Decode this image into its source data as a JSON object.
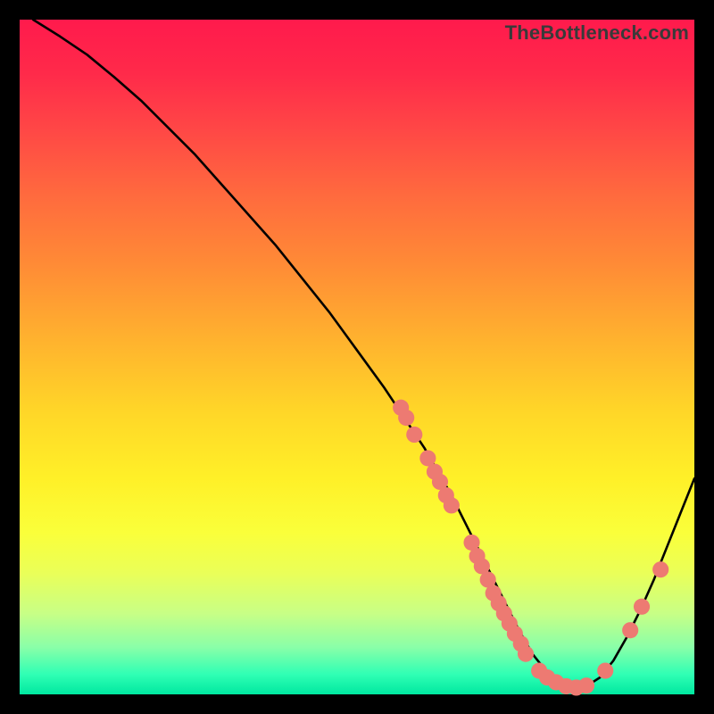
{
  "watermark": "TheBottleneck.com",
  "colors": {
    "dot": "#ed7a72",
    "curve": "#000000",
    "frame_bg_top": "#ff1a4c",
    "frame_bg_bottom": "#00e8a0",
    "page_bg": "#000000"
  },
  "chart_data": {
    "type": "line",
    "title": "",
    "xlabel": "",
    "ylabel": "",
    "xlim": [
      0,
      100
    ],
    "ylim": [
      0,
      100
    ],
    "grid": false,
    "legend": false,
    "series": [
      {
        "name": "curve",
        "x": [
          2,
          6,
          10,
          14,
          18,
          22,
          26,
          30,
          34,
          38,
          42,
          46,
          50,
          54,
          56,
          58,
          60,
          62,
          64,
          66,
          68,
          70,
          72,
          74,
          76,
          78,
          80,
          82,
          84,
          86,
          88,
          90,
          92,
          94,
          96,
          98,
          100
        ],
        "y": [
          100,
          97.5,
          94.8,
          91.5,
          88,
          84,
          80,
          75.5,
          71,
          66.5,
          61.5,
          56.5,
          51,
          45.5,
          42.5,
          39.5,
          36.5,
          33,
          29.5,
          25.5,
          21.5,
          17.5,
          13.5,
          9.5,
          6,
          3.5,
          1.8,
          1,
          1.2,
          2.5,
          5,
          8.5,
          12.5,
          17,
          22,
          27,
          32
        ]
      }
    ],
    "points": [
      {
        "x": 56.5,
        "y": 42.5
      },
      {
        "x": 57.3,
        "y": 41
      },
      {
        "x": 58.5,
        "y": 38.5
      },
      {
        "x": 60.5,
        "y": 35
      },
      {
        "x": 61.5,
        "y": 33
      },
      {
        "x": 62.3,
        "y": 31.5
      },
      {
        "x": 63.2,
        "y": 29.5
      },
      {
        "x": 64,
        "y": 28
      },
      {
        "x": 67,
        "y": 22.5
      },
      {
        "x": 67.8,
        "y": 20.5
      },
      {
        "x": 68.5,
        "y": 19
      },
      {
        "x": 69.4,
        "y": 17
      },
      {
        "x": 70.2,
        "y": 15
      },
      {
        "x": 71,
        "y": 13.5
      },
      {
        "x": 71.8,
        "y": 12
      },
      {
        "x": 72.6,
        "y": 10.5
      },
      {
        "x": 73.4,
        "y": 9
      },
      {
        "x": 74.3,
        "y": 7.5
      },
      {
        "x": 75,
        "y": 6
      },
      {
        "x": 77,
        "y": 3.5
      },
      {
        "x": 78.2,
        "y": 2.5
      },
      {
        "x": 79.5,
        "y": 1.8
      },
      {
        "x": 81,
        "y": 1.2
      },
      {
        "x": 82.5,
        "y": 1
      },
      {
        "x": 84,
        "y": 1.3
      },
      {
        "x": 86.8,
        "y": 3.5
      },
      {
        "x": 90.5,
        "y": 9.5
      },
      {
        "x": 92.2,
        "y": 13
      },
      {
        "x": 95,
        "y": 18.5
      }
    ],
    "point_radius": 1.2
  }
}
